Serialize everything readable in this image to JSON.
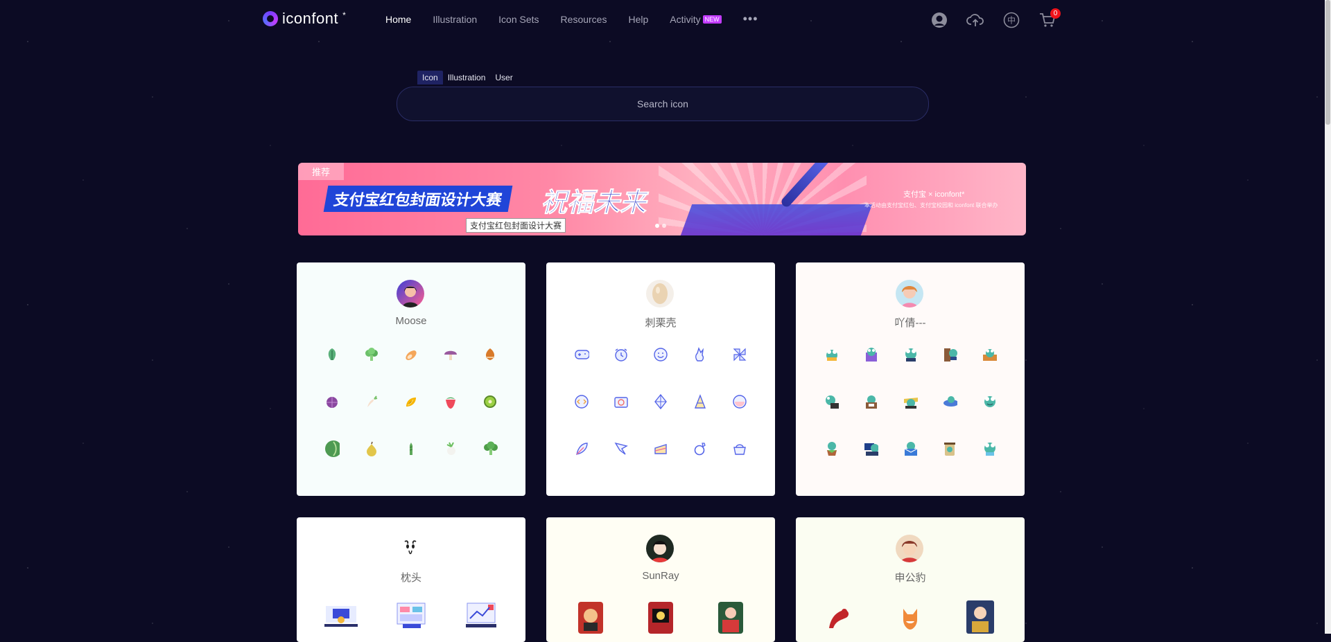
{
  "header": {
    "logo_text": "iconfont",
    "logo_sup": "*",
    "nav": [
      "Home",
      "Illustration",
      "Icon Sets",
      "Resources",
      "Help",
      "Activity"
    ],
    "new_badge": "NEW",
    "more": "•••",
    "cart_count": "0",
    "lang_glyph": "中"
  },
  "search": {
    "tabs": [
      "Icon",
      "Illustration",
      "User"
    ],
    "placeholder": "Search icon"
  },
  "banner": {
    "tag": "推荐",
    "title1": "支付宝红包封面设计大赛",
    "title2": "祝福未来",
    "caption": "支付宝红包封面设计大赛",
    "brand": "支付宝 × iconfont*",
    "fine_print": "本活动由支付宝红包、支付宝校园和 iconfont 联合举办"
  },
  "cards": [
    {
      "user": "Moose",
      "bg": "#f7fdfc"
    },
    {
      "user": "刺栗壳",
      "bg": "#ffffff"
    },
    {
      "user": "吖倩---",
      "bg": "#fffaf9"
    },
    {
      "user": "枕头",
      "bg": "#ffffff"
    },
    {
      "user": "SunRay",
      "bg": "#fffef4"
    },
    {
      "user": "申公豹",
      "bg": "#fbfdf2"
    }
  ],
  "colors": {
    "background": "#0c0b24",
    "accent": "#c33cff",
    "badge_red": "#f0131a"
  }
}
